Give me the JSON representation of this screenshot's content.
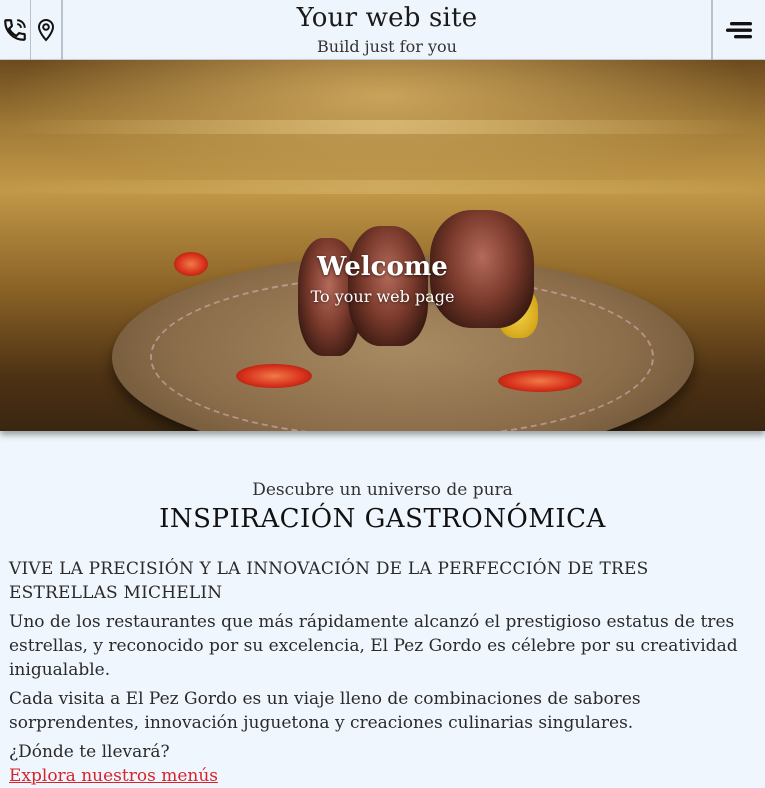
{
  "header": {
    "title": "Your web site",
    "subtitle": "Build just for you",
    "phone_icon": "phone-icon",
    "location_icon": "map-pin-icon",
    "menu_icon": "hamburger-menu-icon"
  },
  "hero": {
    "title": "Welcome",
    "subtitle": "To your web page"
  },
  "section": {
    "intro": "Descubre un universo de pura",
    "headline": "INSPIRACIÓN GASTRONÓMICA",
    "kicker": "VIVE LA PRECISIÓN Y LA INNOVACIÓN DE LA PERFECCIÓN DE TRES ESTRELLAS MICHELIN",
    "paragraph1": "Uno de los restaurantes que más rápidamente alcanzó el prestigioso estatus de tres estrellas, y reconocido por su excelencia, El Pez Gordo es célebre por su creatividad inigualable.",
    "paragraph2": "Cada visita a El Pez Gordo es un viaje lleno de combinaciones de sabores sorprendentes, innovación juguetona y creaciones culinarias singulares.",
    "question": "¿Dónde te llevará?",
    "link": "Explora nuestros menús"
  },
  "colors": {
    "background": "#f0f6fd",
    "link": "#d8232a"
  }
}
